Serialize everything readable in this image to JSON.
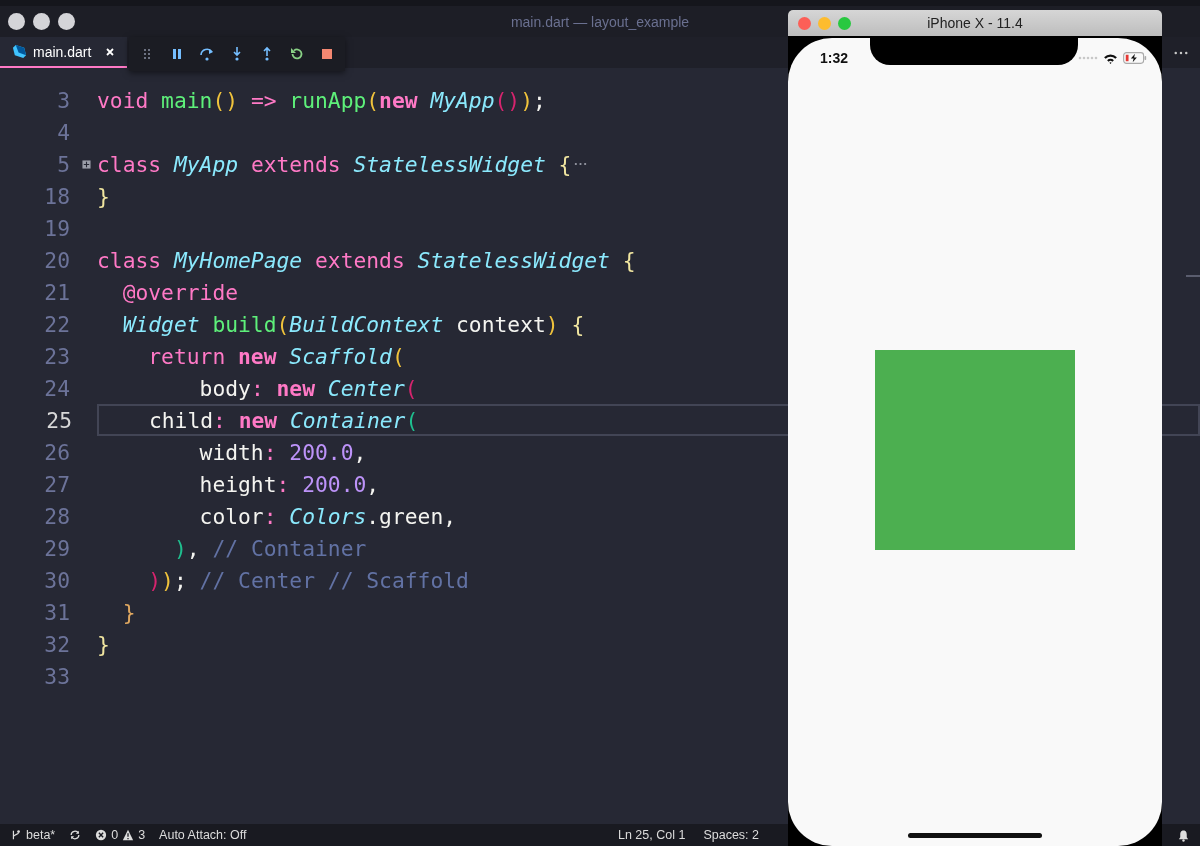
{
  "window": {
    "title": "main.dart — layout_example"
  },
  "tabs": [
    {
      "label": "main.dart",
      "selected": true
    }
  ],
  "editor": {
    "lines": [
      {
        "number": "3",
        "current": false,
        "folded": false,
        "tokens": [
          {
            "kind": "kw",
            "text": "void "
          },
          {
            "kind": "fn",
            "text": "main"
          },
          {
            "kind": "p1",
            "text": "() "
          },
          {
            "kind": "kw",
            "text": "=> "
          },
          {
            "kind": "fn",
            "text": "runApp"
          },
          {
            "kind": "p1",
            "text": "("
          },
          {
            "kind": "new",
            "text": "new "
          },
          {
            "kind": "type",
            "text": "MyApp"
          },
          {
            "kind": "p2",
            "text": "()"
          },
          {
            "kind": "p1",
            "text": ")"
          },
          {
            "kind": "plain",
            "text": ";"
          }
        ]
      },
      {
        "number": "4",
        "current": false,
        "folded": false
      },
      {
        "number": "5",
        "current": false,
        "folded": true,
        "tokens": [
          {
            "kind": "kw",
            "text": "class "
          },
          {
            "kind": "type",
            "text": "MyApp "
          },
          {
            "kind": "kw",
            "text": "extends "
          },
          {
            "kind": "type",
            "text": "StatelessWidget "
          },
          {
            "kind": "brace",
            "text": "{"
          }
        ]
      },
      {
        "number": "18",
        "current": false,
        "folded": false,
        "tokens": [
          {
            "kind": "brace",
            "text": "}"
          }
        ]
      },
      {
        "number": "19",
        "current": false,
        "folded": false
      },
      {
        "number": "20",
        "current": false,
        "folded": false,
        "tokens": [
          {
            "kind": "kw",
            "text": "class "
          },
          {
            "kind": "type",
            "text": "MyHomePage "
          },
          {
            "kind": "kw",
            "text": "extends "
          },
          {
            "kind": "type",
            "text": "StatelessWidget "
          },
          {
            "kind": "brace",
            "text": "{"
          }
        ]
      },
      {
        "number": "21",
        "current": false,
        "folded": false,
        "tokens": [
          {
            "kind": "kw",
            "text": "  @override"
          }
        ]
      },
      {
        "number": "22",
        "current": false,
        "folded": false,
        "tokens": [
          {
            "kind": "type",
            "text": "  Widget "
          },
          {
            "kind": "fn",
            "text": "build"
          },
          {
            "kind": "p1",
            "text": "("
          },
          {
            "kind": "type",
            "text": "BuildContext "
          },
          {
            "kind": "plain",
            "text": "context"
          },
          {
            "kind": "p1",
            "text": ") "
          },
          {
            "kind": "brace",
            "text": "{"
          }
        ]
      },
      {
        "number": "23",
        "current": false,
        "folded": false,
        "tokens": [
          {
            "kind": "kw",
            "text": "    return "
          },
          {
            "kind": "new",
            "text": "new "
          },
          {
            "kind": "type",
            "text": "Scaffold"
          },
          {
            "kind": "p1",
            "text": "("
          }
        ]
      },
      {
        "number": "24",
        "current": false,
        "folded": false,
        "tokens": [
          {
            "kind": "plain",
            "text": "        body"
          },
          {
            "kind": "kw",
            "text": ": "
          },
          {
            "kind": "new",
            "text": "new "
          },
          {
            "kind": "type",
            "text": "Center"
          },
          {
            "kind": "p2",
            "text": "("
          }
        ]
      },
      {
        "number": "25",
        "current": true,
        "folded": false,
        "tokens": [
          {
            "kind": "plain",
            "text": "      child"
          },
          {
            "kind": "kw",
            "text": ": "
          },
          {
            "kind": "new",
            "text": "new "
          },
          {
            "kind": "type",
            "text": "Container"
          },
          {
            "kind": "p3",
            "text": "("
          }
        ]
      },
      {
        "number": "26",
        "current": false,
        "folded": false,
        "tokens": [
          {
            "kind": "plain",
            "text": "        width"
          },
          {
            "kind": "kw",
            "text": ": "
          },
          {
            "kind": "num",
            "text": "200.0"
          },
          {
            "kind": "plain",
            "text": ","
          }
        ]
      },
      {
        "number": "27",
        "current": false,
        "folded": false,
        "tokens": [
          {
            "kind": "plain",
            "text": "        height"
          },
          {
            "kind": "kw",
            "text": ": "
          },
          {
            "kind": "num",
            "text": "200.0"
          },
          {
            "kind": "plain",
            "text": ","
          }
        ]
      },
      {
        "number": "28",
        "current": false,
        "folded": false,
        "tokens": [
          {
            "kind": "plain",
            "text": "        color"
          },
          {
            "kind": "kw",
            "text": ": "
          },
          {
            "kind": "type",
            "text": "Colors"
          },
          {
            "kind": "plain",
            "text": ".green,"
          }
        ]
      },
      {
        "number": "29",
        "current": false,
        "folded": false,
        "tokens": [
          {
            "kind": "p3",
            "text": "      )"
          },
          {
            "kind": "plain",
            "text": ", "
          },
          {
            "kind": "comment",
            "text": "// Container"
          }
        ]
      },
      {
        "number": "30",
        "current": false,
        "folded": false,
        "tokens": [
          {
            "kind": "p2",
            "text": "    )"
          },
          {
            "kind": "p1",
            "text": ")"
          },
          {
            "kind": "plain",
            "text": "; "
          },
          {
            "kind": "comment",
            "text": "// Center // Scaffold"
          }
        ]
      },
      {
        "number": "31",
        "current": false,
        "folded": false,
        "tokens": [
          {
            "kind": "brace2",
            "text": "  }"
          }
        ]
      },
      {
        "number": "32",
        "current": false,
        "folded": false,
        "tokens": [
          {
            "kind": "brace",
            "text": "}"
          }
        ]
      },
      {
        "number": "33",
        "current": false,
        "folded": false
      }
    ]
  },
  "status_bar": {
    "branch": "beta*",
    "errors": "0",
    "warnings": "3",
    "auto_attach": "Auto Attach: Off",
    "position": "Ln 25, Col 1",
    "spaces": "Spaces: 2"
  },
  "simulator": {
    "title": "iPhone X - 11.4",
    "time": "1:32"
  }
}
